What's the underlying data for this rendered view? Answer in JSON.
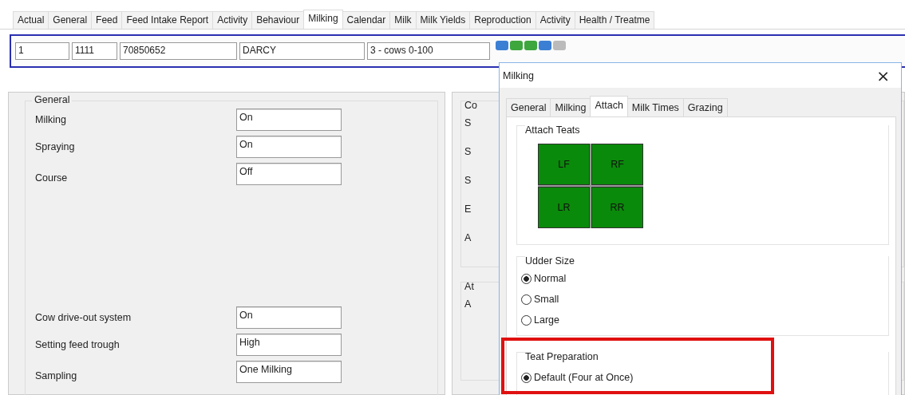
{
  "tabs": [
    {
      "label": "Actual",
      "selected": false
    },
    {
      "label": "General",
      "selected": false
    },
    {
      "label": "Feed",
      "selected": false
    },
    {
      "label": "Feed Intake Report",
      "selected": false
    },
    {
      "label": "Activity",
      "selected": false
    },
    {
      "label": "Behaviour",
      "selected": false
    },
    {
      "label": "Milking",
      "selected": true
    },
    {
      "label": "Calendar",
      "selected": false
    },
    {
      "label": "Milk",
      "selected": false
    },
    {
      "label": "Milk Yields",
      "selected": false
    },
    {
      "label": "Reproduction",
      "selected": false
    },
    {
      "label": "Activity",
      "selected": false
    },
    {
      "label": "Health / Treatme",
      "selected": false
    }
  ],
  "header_fields": [
    "1",
    "1111",
    "70850652",
    "DARCY",
    "3 - cows 0-100"
  ],
  "general_group": {
    "title": "General",
    "rows_top": [
      {
        "label": "Milking",
        "value": "On"
      },
      {
        "label": "Spraying",
        "value": "On"
      },
      {
        "label": "Course",
        "value": "Off"
      }
    ],
    "rows_bottom": [
      {
        "label": "Cow drive-out system",
        "value": "On"
      },
      {
        "label": "Setting feed trough",
        "value": "High"
      },
      {
        "label": "Sampling",
        "value": "One Milking"
      }
    ]
  },
  "right_panel": {
    "group_1_title": "Co",
    "group_1_labels": [
      "S",
      "S",
      "S",
      "E",
      "A"
    ],
    "group_2_title": "At",
    "group_2_labels": [
      "A"
    ]
  },
  "dialog": {
    "title": "Milking",
    "close": "×",
    "tabs": [
      {
        "label": "General",
        "selected": false
      },
      {
        "label": "Milking",
        "selected": false
      },
      {
        "label": "Attach",
        "selected": true
      },
      {
        "label": "Milk Times",
        "selected": false
      },
      {
        "label": "Grazing",
        "selected": false
      }
    ],
    "attach_teats": {
      "title": "Attach Teats",
      "teats": [
        {
          "label": "LF",
          "on": true
        },
        {
          "label": "RF",
          "on": true
        },
        {
          "label": "LR",
          "on": true
        },
        {
          "label": "RR",
          "on": true
        }
      ]
    },
    "udder_size": {
      "title": "Udder Size",
      "options": [
        {
          "label": "Normal",
          "selected": true
        },
        {
          "label": "Small",
          "selected": false
        },
        {
          "label": "Large",
          "selected": false
        }
      ]
    },
    "teat_preparation": {
      "title": "Teat Preparation",
      "highlighted": true,
      "options": [
        {
          "label": "Default (Four at Once)",
          "selected": true
        }
      ]
    }
  }
}
